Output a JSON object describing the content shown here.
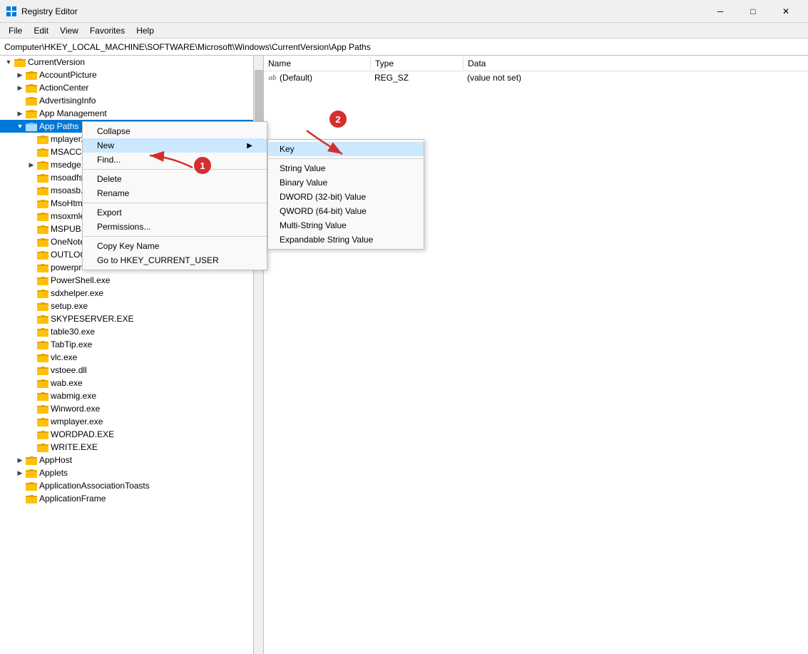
{
  "titleBar": {
    "icon": "registry-editor-icon",
    "title": "Registry Editor",
    "minimize": "─",
    "maximize": "□",
    "close": "✕"
  },
  "menuBar": {
    "items": [
      "File",
      "Edit",
      "View",
      "Favorites",
      "Help"
    ]
  },
  "addressBar": {
    "path": "Computer\\HKEY_LOCAL_MACHINE\\SOFTWARE\\Microsoft\\Windows\\CurrentVersion\\App Paths"
  },
  "treePanel": {
    "items": [
      {
        "label": "CurrentVersion",
        "indent": 0,
        "expanded": true,
        "selected": false
      },
      {
        "label": "AccountPicture",
        "indent": 1,
        "expanded": false,
        "selected": false
      },
      {
        "label": "ActionCenter",
        "indent": 1,
        "expanded": false,
        "selected": false
      },
      {
        "label": "AdvertisingInfo",
        "indent": 1,
        "expanded": false,
        "selected": false
      },
      {
        "label": "App Management",
        "indent": 1,
        "expanded": false,
        "selected": false
      },
      {
        "label": "App Paths",
        "indent": 1,
        "expanded": true,
        "selected": true
      },
      {
        "label": "mplayer2.exe",
        "indent": 2,
        "expanded": false
      },
      {
        "label": "MSACCESS.EXE",
        "indent": 2,
        "expanded": false
      },
      {
        "label": "msedge.exe",
        "indent": 2,
        "expanded": false
      },
      {
        "label": "msoadfsb.exe",
        "indent": 2,
        "expanded": false
      },
      {
        "label": "msoasb.exe",
        "indent": 2,
        "expanded": false
      },
      {
        "label": "MsoHtmEd.exe",
        "indent": 2,
        "expanded": false
      },
      {
        "label": "msoxmled.exe",
        "indent": 2,
        "expanded": false
      },
      {
        "label": "MSPUB.EXE",
        "indent": 2,
        "expanded": false
      },
      {
        "label": "OneNote.exe",
        "indent": 2,
        "expanded": false
      },
      {
        "label": "OUTLOOK.EXE",
        "indent": 2,
        "expanded": false
      },
      {
        "label": "powerpnt.exe",
        "indent": 2,
        "expanded": false
      },
      {
        "label": "PowerShell.exe",
        "indent": 2,
        "expanded": false
      },
      {
        "label": "sdxhelper.exe",
        "indent": 2,
        "expanded": false
      },
      {
        "label": "setup.exe",
        "indent": 2,
        "expanded": false
      },
      {
        "label": "SKYPESERVER.EXE",
        "indent": 2,
        "expanded": false
      },
      {
        "label": "table30.exe",
        "indent": 2,
        "expanded": false
      },
      {
        "label": "TabTip.exe",
        "indent": 2,
        "expanded": false
      },
      {
        "label": "vlc.exe",
        "indent": 2,
        "expanded": false
      },
      {
        "label": "vstoee.dll",
        "indent": 2,
        "expanded": false
      },
      {
        "label": "wab.exe",
        "indent": 2,
        "expanded": false
      },
      {
        "label": "wabmig.exe",
        "indent": 2,
        "expanded": false
      },
      {
        "label": "Winword.exe",
        "indent": 2,
        "expanded": false
      },
      {
        "label": "wmplayer.exe",
        "indent": 2,
        "expanded": false
      },
      {
        "label": "WORDPAD.EXE",
        "indent": 2,
        "expanded": false
      },
      {
        "label": "WRITE.EXE",
        "indent": 2,
        "expanded": false
      },
      {
        "label": "AppHost",
        "indent": 1,
        "expanded": false
      },
      {
        "label": "Applets",
        "indent": 1,
        "expanded": false
      },
      {
        "label": "ApplicationAssociationToasts",
        "indent": 1,
        "expanded": false
      },
      {
        "label": "ApplicationFrame",
        "indent": 1,
        "expanded": false
      }
    ]
  },
  "rightPanel": {
    "columns": [
      "Name",
      "Type",
      "Data"
    ],
    "rows": [
      {
        "name": "(Default)",
        "type": "REG_SZ",
        "data": "(value not set)",
        "hasIcon": true
      }
    ]
  },
  "contextMenu": {
    "items": [
      {
        "label": "Collapse",
        "id": "collapse"
      },
      {
        "label": "New",
        "id": "new",
        "hasArrow": true
      },
      {
        "label": "Find...",
        "id": "find"
      },
      {
        "separator": true
      },
      {
        "label": "Delete",
        "id": "delete"
      },
      {
        "label": "Rename",
        "id": "rename"
      },
      {
        "separator": true
      },
      {
        "label": "Export",
        "id": "export"
      },
      {
        "label": "Permissions...",
        "id": "permissions"
      },
      {
        "separator": true
      },
      {
        "label": "Copy Key Name",
        "id": "copy-key-name"
      },
      {
        "label": "Go to HKEY_CURRENT_USER",
        "id": "go-to-hkey"
      }
    ]
  },
  "submenu": {
    "items": [
      {
        "label": "Key",
        "id": "key",
        "highlighted": true
      },
      {
        "separator": true
      },
      {
        "label": "String Value",
        "id": "string-value"
      },
      {
        "label": "Binary Value",
        "id": "binary-value"
      },
      {
        "label": "DWORD (32-bit) Value",
        "id": "dword-value"
      },
      {
        "label": "QWORD (64-bit) Value",
        "id": "qword-value"
      },
      {
        "label": "Multi-String Value",
        "id": "multi-string-value"
      },
      {
        "label": "Expandable String Value",
        "id": "expandable-string-value"
      }
    ]
  },
  "badges": {
    "badge1": "1",
    "badge2": "2"
  }
}
